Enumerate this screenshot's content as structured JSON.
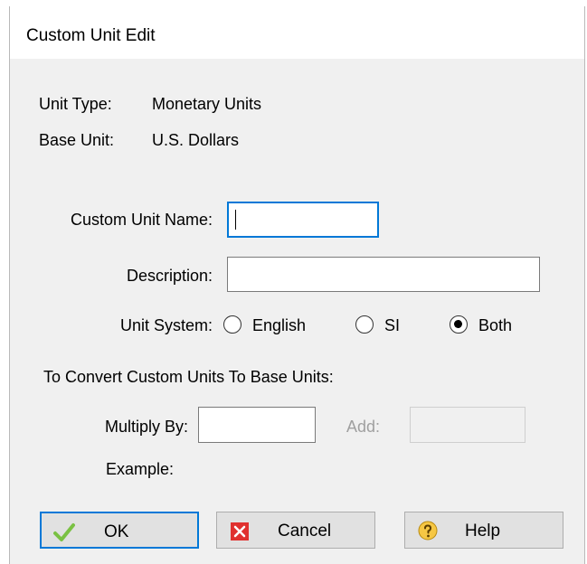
{
  "window": {
    "title": "Custom Unit Edit"
  },
  "info": {
    "unit_type_label": "Unit Type:",
    "unit_type_value": "Monetary Units",
    "base_unit_label": "Base Unit:",
    "base_unit_value": "U.S. Dollars"
  },
  "form": {
    "custom_unit_name_label": "Custom Unit Name:",
    "custom_unit_name_value": "",
    "description_label": "Description:",
    "description_value": "",
    "unit_system_label": "Unit System:",
    "unit_system_options": [
      {
        "label": "English",
        "selected": false
      },
      {
        "label": "SI",
        "selected": false
      },
      {
        "label": "Both",
        "selected": true
      }
    ],
    "convert_heading": "To Convert Custom Units To Base Units:",
    "multiply_by_label": "Multiply By:",
    "multiply_by_value": "",
    "add_label": "Add:",
    "add_value": "",
    "example_label": "Example:"
  },
  "buttons": {
    "ok_label": "OK",
    "cancel_label": "Cancel",
    "help_label": "Help"
  },
  "colors": {
    "accent": "#0078d7",
    "ok_check": "#7ac143",
    "cancel_red": "#e0312f",
    "help_yellow": "#f6c744"
  }
}
